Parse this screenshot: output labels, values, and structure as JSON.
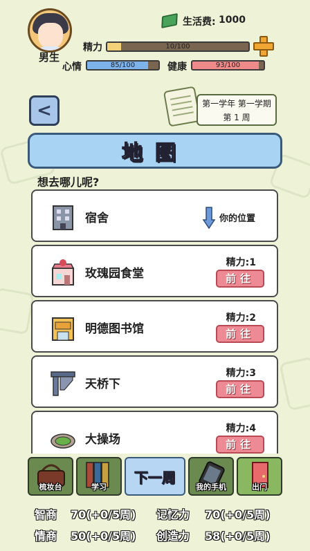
{
  "header": {
    "gender": "男生",
    "money_label": "生活费:",
    "money_value": "1000"
  },
  "stats": {
    "energy": {
      "label": "精力",
      "text": "10/100",
      "value": 10,
      "max": 100,
      "color": "#f4d27a"
    },
    "mood": {
      "label": "心情",
      "text": "85/100",
      "value": 85,
      "max": 100,
      "color": "#7eb2ea"
    },
    "health": {
      "label": "健康",
      "text": "93/100",
      "value": 93,
      "max": 100,
      "color": "#ee8a8a"
    }
  },
  "term": {
    "line1": "第一学年 第一学期",
    "line2": "第 1 周"
  },
  "title": "地图",
  "prompt": "想去哪儿呢?",
  "locations": [
    {
      "name": "宿舍",
      "icon": "dorm-building-icon",
      "here": "你的位置"
    },
    {
      "name": "玫瑰园食堂",
      "icon": "cafeteria-icon",
      "cost": "精力:1",
      "go": "前往"
    },
    {
      "name": "明德图书馆",
      "icon": "library-icon",
      "cost": "精力:2",
      "go": "前往"
    },
    {
      "name": "天桥下",
      "icon": "overpass-icon",
      "cost": "精力:3",
      "go": "前往"
    },
    {
      "name": "大操场",
      "icon": "sports-field-icon",
      "cost": "精力:4",
      "go": "前往"
    }
  ],
  "nav": {
    "dresser": "梳妆台",
    "study": "学习",
    "next_week": "下一周",
    "phone": "我的手机",
    "go_out": "出门"
  },
  "attributes": {
    "iq_label": "智商",
    "iq_value": "70(+0/5周)",
    "memory_label": "记忆力",
    "memory_value": "70(+0/5周)",
    "eq_label": "情商",
    "eq_value": "50(+0/5周)",
    "creativity_label": "创造力",
    "creativity_value": "58(+0/5周)"
  },
  "colors": {
    "accent_blue": "#a9d3f2",
    "go_button": "#ee8a93",
    "background": "#eef2d6"
  }
}
